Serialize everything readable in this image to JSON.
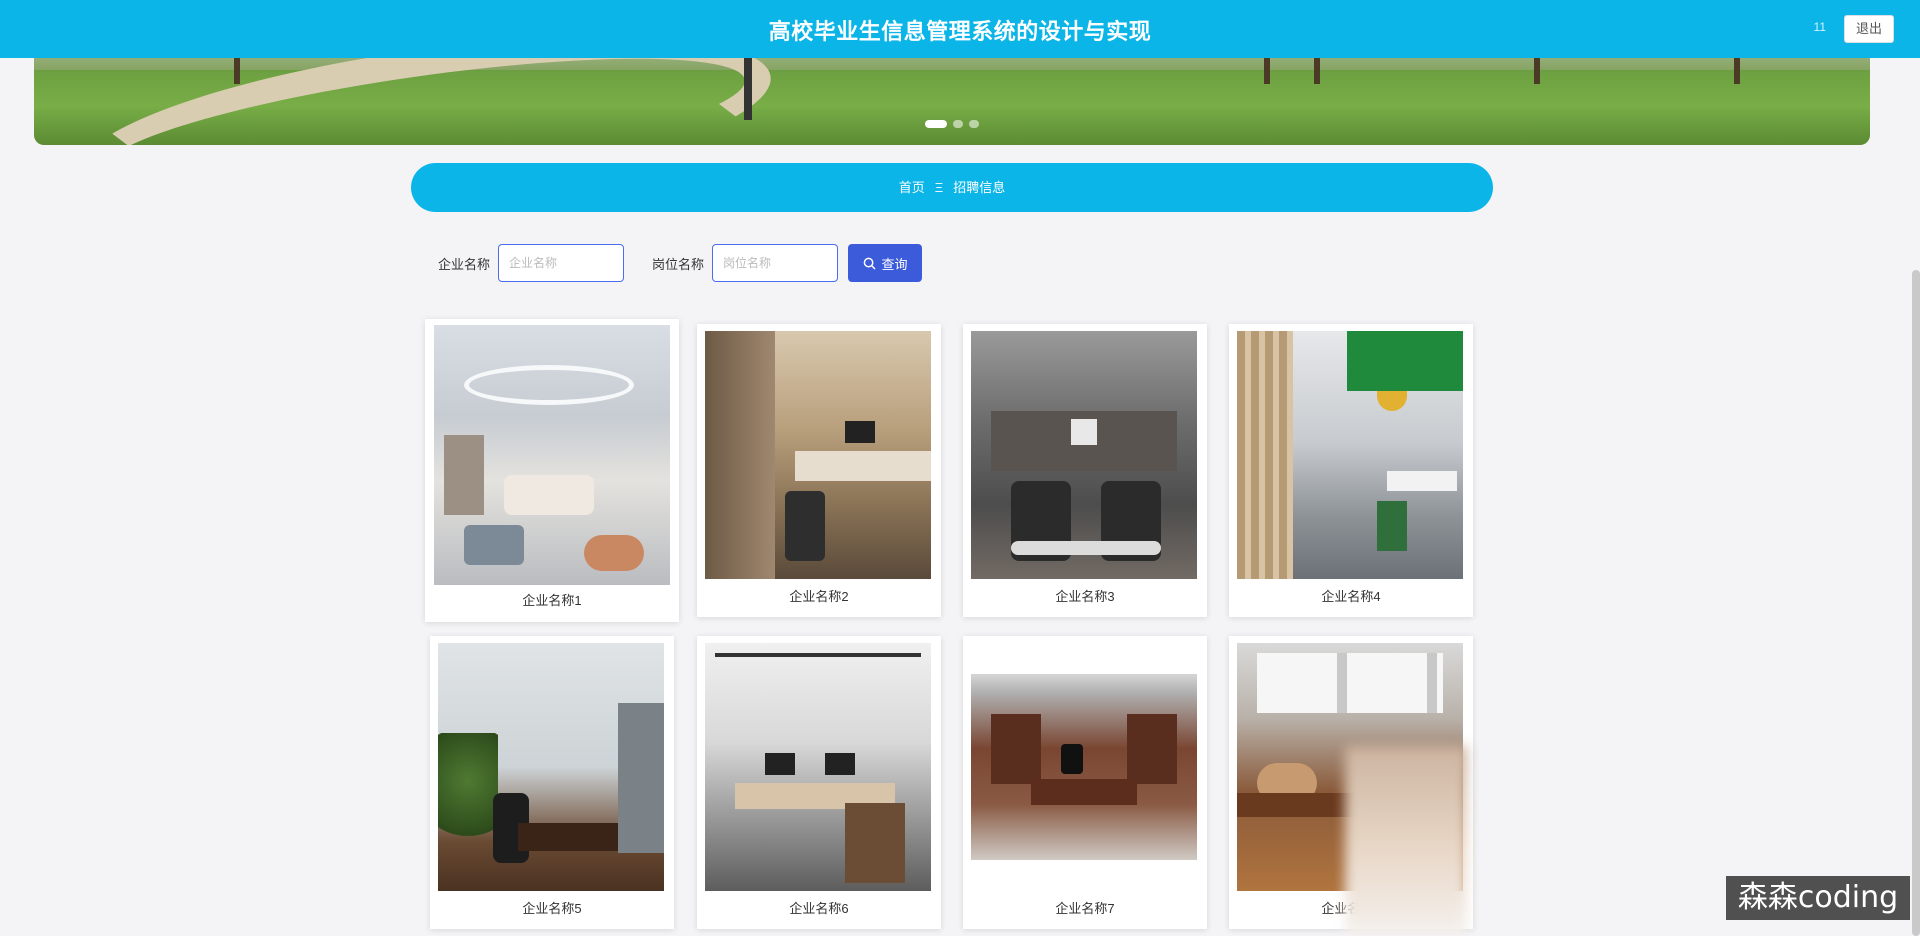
{
  "header": {
    "title": "高校毕业生信息管理系统的设计与实现",
    "user_text": "11",
    "logout_label": "退出"
  },
  "banner": {
    "active_slide": 1,
    "slide_count": 3
  },
  "breadcrumb": {
    "home": "首页",
    "separator": "Ξ",
    "current": "招聘信息"
  },
  "search": {
    "company_label": "企业名称",
    "company_placeholder": "企业名称",
    "company_value": "",
    "position_label": "岗位名称",
    "position_placeholder": "岗位名称",
    "position_value": "",
    "button_label": "查询",
    "button_icon": "search-icon"
  },
  "cards": [
    {
      "name": "企业名称1"
    },
    {
      "name": "企业名称2"
    },
    {
      "name": "企业名称3"
    },
    {
      "name": "企业名称4"
    },
    {
      "name": "企业名称5"
    },
    {
      "name": "企业名称6"
    },
    {
      "name": "企业名称7"
    },
    {
      "name": "企业名称8"
    }
  ],
  "overlay": {
    "watermark": "森森coding"
  },
  "colors": {
    "primary": "#0bb5e8",
    "button": "#3b5bdb",
    "input_border": "#4a6cf0",
    "background": "#f4f4f6"
  }
}
